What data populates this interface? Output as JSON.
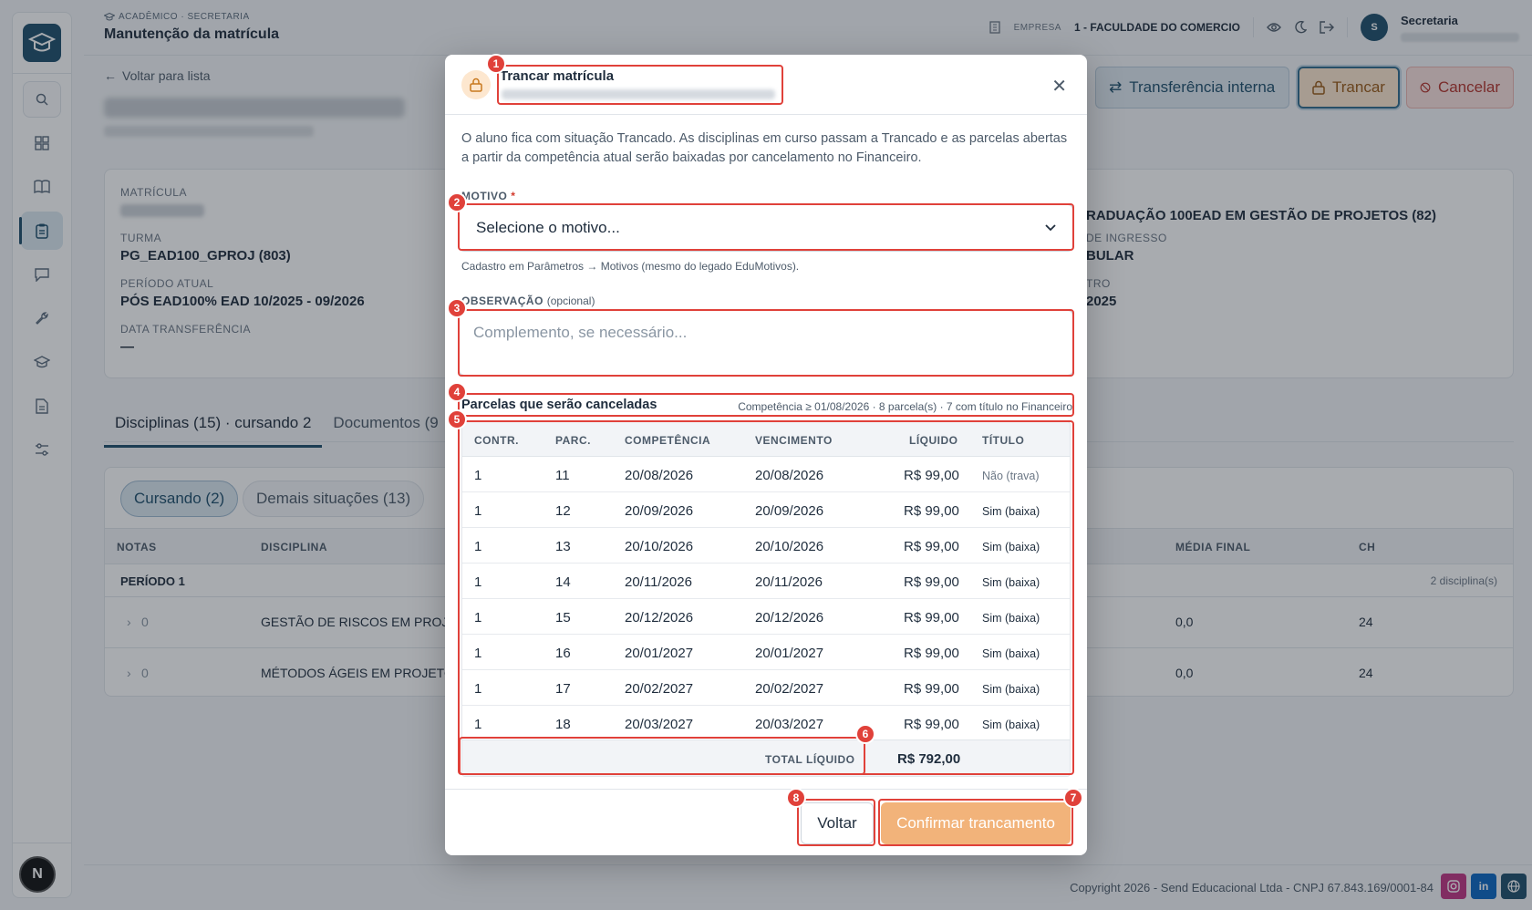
{
  "header": {
    "breadcrumb": "ACADÊMICO · SECRETARIA",
    "title": "Manutenção da matrícula",
    "empresa_label": "EMPRESA",
    "empresa_value": "1 - FACULDADE DO COMERCIO",
    "user_initial": "S",
    "user_name": "Secretaria"
  },
  "page": {
    "back_label": "Voltar para lista",
    "actions": {
      "transfer": "Transferência interna",
      "trancar": "Trancar",
      "cancelar": "Cancelar"
    }
  },
  "info": {
    "matricula_label": "MATRÍCULA",
    "turma_label": "TURMA",
    "turma_value": "PG_EAD100_GPROJ (803)",
    "periodo_label": "PERÍODO ATUAL",
    "periodo_value": "PÓS EAD100% EAD 10/2025 - 09/2026",
    "data_transf_label": "DATA TRANSFERÊNCIA",
    "data_transf_value": "—",
    "curso_value": "RADUAÇÃO 100EAD EM GESTÃO DE PROJETOS (82)",
    "ingresso_label": "DE INGRESSO",
    "ingresso_value": "BULAR",
    "tro_label": "TRO",
    "tro_value": "2025"
  },
  "tabs": [
    {
      "label": "Disciplinas (15) · cursando 2"
    },
    {
      "label": "Documentos (9"
    }
  ],
  "disciplinas": {
    "pill_on": "Cursando (2)",
    "pill_off": "Demais situações (13)",
    "columns": {
      "notas": "NOTAS",
      "disciplina": "DISCIPLINA",
      "media": "MÉDIA FINAL",
      "ch": "CH"
    },
    "period_label": "PERÍODO 1",
    "period_count": "2 disciplina(s)",
    "rows": [
      {
        "nota": "0",
        "nome": "GESTÃO DE RISCOS EM PROJE",
        "media": "0,0",
        "ch": "24"
      },
      {
        "nota": "0",
        "nome": "MÉTODOS ÁGEIS EM PROJETO",
        "media": "0,0",
        "ch": "24"
      }
    ]
  },
  "footer": {
    "copyright": "Copyright 2026 - Send Educacional Ltda - CNPJ 67.843.169/0001-84",
    "social": [
      "instagram-icon",
      "linkedin-icon",
      "globe-icon"
    ]
  },
  "modal": {
    "title": "Trancar matrícula",
    "description": "O aluno fica com situação Trancado. As disciplinas em curso passam a Trancado e as parcelas abertas a partir da competência atual serão baixadas por cancelamento no Financeiro.",
    "motivo_label": "MOTIVO",
    "motivo_required": "*",
    "motivo_placeholder": "Selecione o motivo...",
    "motivo_hint": "Cadastro em Parâmetros → Motivos (mesmo do legado EduMotivos).",
    "obs_label": "OBSERVAÇÃO",
    "obs_optional": "(opcional)",
    "obs_placeholder": "Complemento, se necessário...",
    "parcelas_title": "Parcelas que serão canceladas",
    "parcelas_meta": "Competência ≥ 01/08/2026 · 8 parcela(s) · 7 com título no Financeiro",
    "columns": {
      "contr": "CONTR.",
      "parc": "PARC.",
      "competencia": "COMPETÊNCIA",
      "vencimento": "VENCIMENTO",
      "liquido": "LÍQUIDO",
      "titulo": "TÍTULO"
    },
    "rows": [
      {
        "contr": "1",
        "parc": "11",
        "competencia": "20/08/2026",
        "vencimento": "20/08/2026",
        "liquido": "R$ 99,00",
        "titulo": "Não (trava)"
      },
      {
        "contr": "1",
        "parc": "12",
        "competencia": "20/09/2026",
        "vencimento": "20/09/2026",
        "liquido": "R$ 99,00",
        "titulo": "Sim (baixa)"
      },
      {
        "contr": "1",
        "parc": "13",
        "competencia": "20/10/2026",
        "vencimento": "20/10/2026",
        "liquido": "R$ 99,00",
        "titulo": "Sim (baixa)"
      },
      {
        "contr": "1",
        "parc": "14",
        "competencia": "20/11/2026",
        "vencimento": "20/11/2026",
        "liquido": "R$ 99,00",
        "titulo": "Sim (baixa)"
      },
      {
        "contr": "1",
        "parc": "15",
        "competencia": "20/12/2026",
        "vencimento": "20/12/2026",
        "liquido": "R$ 99,00",
        "titulo": "Sim (baixa)"
      },
      {
        "contr": "1",
        "parc": "16",
        "competencia": "20/01/2027",
        "vencimento": "20/01/2027",
        "liquido": "R$ 99,00",
        "titulo": "Sim (baixa)"
      },
      {
        "contr": "1",
        "parc": "17",
        "competencia": "20/02/2027",
        "vencimento": "20/02/2027",
        "liquido": "R$ 99,00",
        "titulo": "Sim (baixa)"
      },
      {
        "contr": "1",
        "parc": "18",
        "competencia": "20/03/2027",
        "vencimento": "20/03/2027",
        "liquido": "R$ 99,00",
        "titulo": "Sim (baixa)"
      }
    ],
    "total_label": "TOTAL LÍQUIDO",
    "total_value": "R$ 792,00",
    "voltar_label": "Voltar",
    "confirm_label": "Confirmar trancamento"
  },
  "annotations": [
    "1",
    "2",
    "3",
    "4",
    "5",
    "6",
    "7",
    "8"
  ],
  "colors": {
    "brand": "#1d4e6b",
    "warning": "#f2b37a",
    "danger": "#e0413a"
  }
}
